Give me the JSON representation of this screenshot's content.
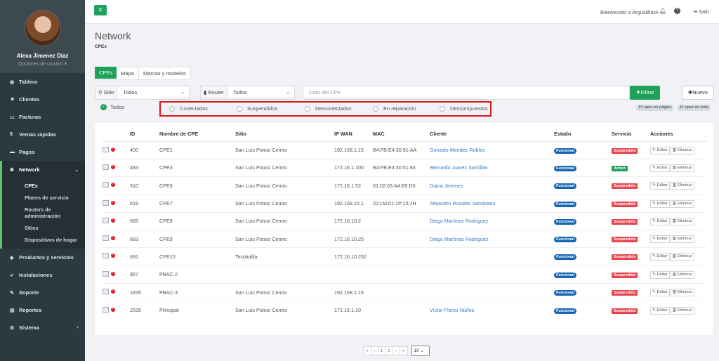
{
  "user": {
    "name": "Alexa Jimenez Díaz",
    "options": "Opciones de usuario ▾"
  },
  "nav": [
    {
      "icon": "dashboard-icon",
      "glyph": "◍",
      "label": "Tablero"
    },
    {
      "icon": "users-icon",
      "glyph": "☻",
      "label": "Clientes"
    },
    {
      "icon": "invoice-icon",
      "glyph": "▭",
      "label": "Facturas"
    },
    {
      "icon": "dollar-icon",
      "glyph": "$",
      "label": "Ventas rápidas"
    },
    {
      "icon": "payments-icon",
      "glyph": "▬",
      "label": "Pagos"
    }
  ],
  "network": {
    "label": "Network",
    "glyph": "✱",
    "sub": [
      "CPEs",
      "Planes de servicio",
      "Routers de administración",
      "Sitios",
      "Dispositivos de hogar"
    ]
  },
  "nav2": [
    {
      "icon": "tag-icon",
      "glyph": "◈",
      "label": "Productos y servicios"
    },
    {
      "icon": "rocket-icon",
      "glyph": "➶",
      "label": "Instalaciones"
    },
    {
      "icon": "wrench-icon",
      "glyph": "✎",
      "label": "Soporte"
    },
    {
      "icon": "reports-icon",
      "glyph": "▤",
      "label": "Reportes"
    },
    {
      "icon": "gears-icon",
      "glyph": "⚙",
      "label": "Sistema"
    }
  ],
  "topbar": {
    "welcome": "Bienvenido a ArgusBlack",
    "logout": "Salir"
  },
  "page": {
    "title": "Network",
    "breadcrumb": "CPEs"
  },
  "tabs": [
    "CPEs",
    "Mapa",
    "Marcas y modelos"
  ],
  "filters": {
    "site_label": "Sitio",
    "site_value": "Todos",
    "router_label": "Router",
    "router_value": "Todos",
    "search_placeholder": "Dato del CPE",
    "filter_button": "Filtrar",
    "new_button": "Nuevo",
    "all_label": "Todos",
    "statuses": [
      "Conectados",
      "Suspendidos",
      "Desconectados",
      "En reparación",
      "Descompuestos"
    ],
    "count_page": "10 cpes en página",
    "count_total": "11 cpes en total"
  },
  "table": {
    "headers": [
      "ID",
      "Nombre de CPE",
      "Sitio",
      "IP WAN",
      "MAC",
      "Cliente",
      "Estado",
      "Servicio",
      "Acciones"
    ],
    "edit": "Editar",
    "delete": "Eliminar",
    "rows": [
      {
        "id": "400",
        "name": "CPE1",
        "site": "San Luis Potosí Centro",
        "ip": "192.168.1.15",
        "mac": "B4:FB:E4:30:51:AA",
        "client": "Gonzalo Mendez Robles",
        "state": "Funcional",
        "service": "Suspendido"
      },
      {
        "id": "483",
        "name": "CPE3",
        "site": "San Luis Potosí Centro",
        "ip": "172.16.1.100",
        "mac": "B4:FB:E4:30:51:83",
        "client": "Bernardo Juarez Santillan",
        "state": "Funcional",
        "service": "Activo"
      },
      {
        "id": "510",
        "name": "CPE6",
        "site": "San Luis Potosí Centro",
        "ip": "172.16.1.52",
        "mac": "01:02:03:A4:B5:D6",
        "client": "Diana Jimenez",
        "state": "Funcional",
        "service": "Suspendido"
      },
      {
        "id": "619",
        "name": "CPE7",
        "site": "San Luis Potosí Centro",
        "ip": "192.168.15.1",
        "mac": "02:LM:01:1P:15:JH",
        "client": "Alejandro Rosales Sambrano",
        "state": "Funcional",
        "service": "Suspendido"
      },
      {
        "id": "665",
        "name": "CPE8",
        "site": "San Luis Potosí Centro",
        "ip": "172.16.10.2",
        "mac": "",
        "client": "Diego Martínez Rodriguez",
        "state": "Funcional",
        "service": "Suspendido"
      },
      {
        "id": "683",
        "name": "CPE9",
        "site": "San Luis Potosí Centro",
        "ip": "172.16.10.25",
        "mac": "",
        "client": "Diego Martínez Rodriguez",
        "state": "Funcional",
        "service": "Suspendido"
      },
      {
        "id": "691",
        "name": "CPE10",
        "site": "Tecolutilla",
        "ip": "172.16.10.252",
        "mac": "",
        "client": "",
        "state": "Funcional",
        "service": "Suspendido"
      },
      {
        "id": "857",
        "name": "PBAC-2",
        "site": "",
        "ip": "",
        "mac": "",
        "client": "",
        "state": "Funcional",
        "service": "Suspendido"
      },
      {
        "id": "1835",
        "name": "PBAC-3",
        "site": "San Luis Potosí Centro",
        "ip": "192.168.1.15",
        "mac": "",
        "client": "",
        "state": "Funcional",
        "service": "Suspendido"
      },
      {
        "id": "2535",
        "name": "Principal",
        "site": "San Luis Potosí Centro",
        "ip": "172.16.1.10",
        "mac": "",
        "client": "Víctor Flores Núñez",
        "state": "Funcional",
        "service": "Suspendido"
      }
    ]
  },
  "pagination": {
    "pages": [
      "«",
      "‹",
      "1",
      "2",
      "›",
      "»"
    ],
    "per_page": "10"
  }
}
